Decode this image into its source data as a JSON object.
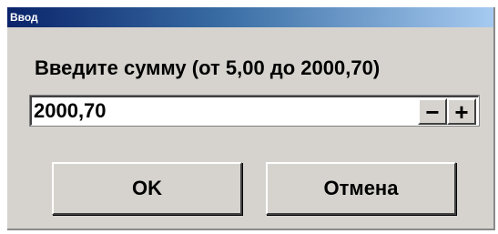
{
  "window": {
    "title": "Ввод"
  },
  "prompt": {
    "text": "Введите сумму (от 5,00 до 2000,70)"
  },
  "amount": {
    "value": "2000,70"
  },
  "stepper": {
    "decrement_label": "−",
    "increment_label": "+"
  },
  "buttons": {
    "ok_label": "OK",
    "cancel_label": "Отмена"
  },
  "colors": {
    "dialog_bg": "#d6d3ce",
    "titlebar_start": "#0a246a",
    "titlebar_end": "#a6caf0"
  }
}
